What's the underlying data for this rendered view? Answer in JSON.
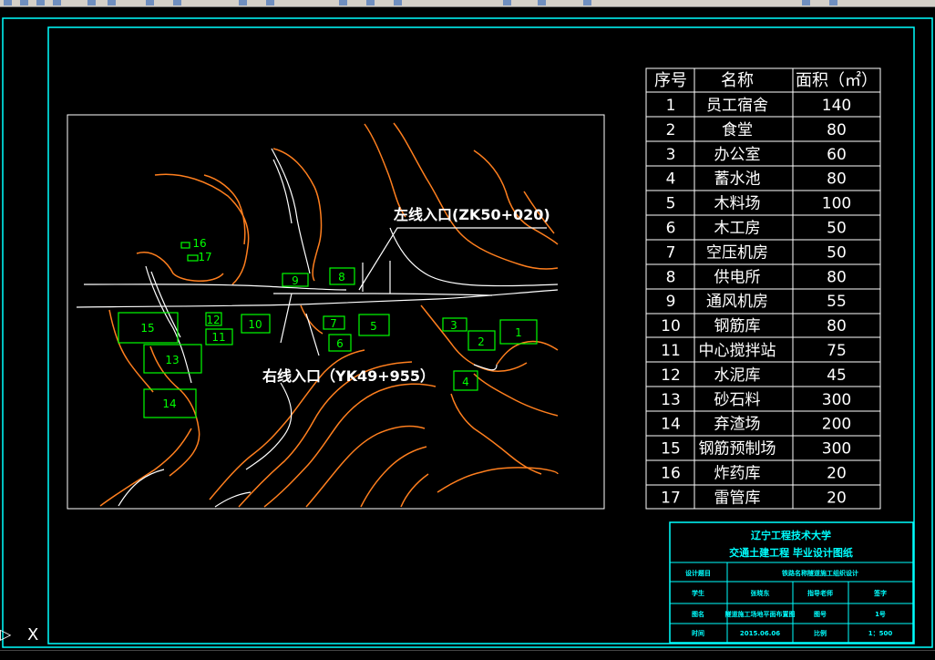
{
  "labels": {
    "left_entrance": "左线入口(ZK50+020)",
    "right_entrance": "右线入口（YK49+955）",
    "cursor_axis": "X"
  },
  "site_markers": [
    {
      "id": "1"
    },
    {
      "id": "2"
    },
    {
      "id": "3"
    },
    {
      "id": "4"
    },
    {
      "id": "5"
    },
    {
      "id": "6"
    },
    {
      "id": "7"
    },
    {
      "id": "8"
    },
    {
      "id": "9"
    },
    {
      "id": "10"
    },
    {
      "id": "11"
    },
    {
      "id": "12"
    },
    {
      "id": "13"
    },
    {
      "id": "14"
    },
    {
      "id": "15"
    },
    {
      "id": "16"
    },
    {
      "id": "17"
    }
  ],
  "table": {
    "headers": [
      "序号",
      "名称",
      "面积（㎡）"
    ],
    "rows": [
      [
        "1",
        "员工宿舍",
        "140"
      ],
      [
        "2",
        "食堂",
        "80"
      ],
      [
        "3",
        "办公室",
        "60"
      ],
      [
        "4",
        "蓄水池",
        "80"
      ],
      [
        "5",
        "木料场",
        "100"
      ],
      [
        "6",
        "木工房",
        "50"
      ],
      [
        "7",
        "空压机房",
        "50"
      ],
      [
        "8",
        "供电所",
        "80"
      ],
      [
        "9",
        "通风机房",
        "55"
      ],
      [
        "10",
        "钢筋库",
        "80"
      ],
      [
        "11",
        "中心搅拌站",
        "75"
      ],
      [
        "12",
        "水泥库",
        "45"
      ],
      [
        "13",
        "砂石料",
        "300"
      ],
      [
        "14",
        "弃渣场",
        "200"
      ],
      [
        "15",
        "钢筋预制场",
        "300"
      ],
      [
        "16",
        "炸药库",
        "20"
      ],
      [
        "17",
        "雷管库",
        "20"
      ]
    ]
  },
  "title_block": {
    "school": "辽宁工程技术大学",
    "subtitle": "交通土建工程 毕业设计图纸",
    "row1_label": "设计题目",
    "row1_value": "铁路名称隧道施工组织设计",
    "row2": [
      "学生",
      "张晓东",
      "指导老师",
      "签字"
    ],
    "row3": [
      "图名",
      "隧道施工场地平面布置图",
      "图号",
      "1号"
    ],
    "row4": [
      "时间",
      "2015.06.06",
      "比例",
      "1：500"
    ]
  },
  "colors": {
    "background": "#000000",
    "frame": "#00ffff",
    "contour": "#ff7f1e",
    "road": "#ffffff",
    "markers": "#00ff00",
    "text": "#ffffff"
  }
}
